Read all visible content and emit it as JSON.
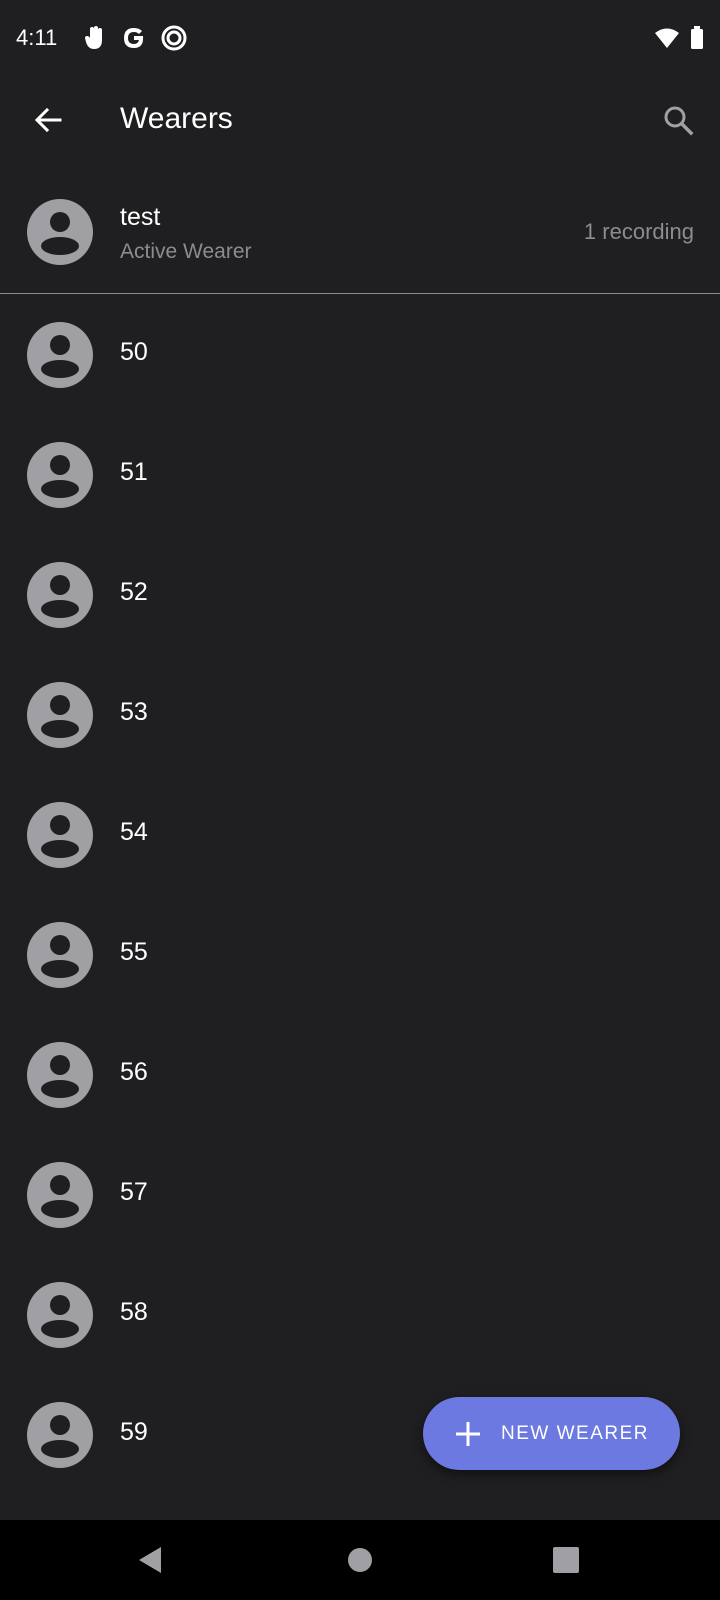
{
  "status_bar": {
    "time": "4:11",
    "left_icons": [
      "hand-icon",
      "google-icon",
      "circle-app-icon"
    ],
    "right_icons": [
      "wifi-icon",
      "battery-icon"
    ]
  },
  "app_bar": {
    "title": "Wearers",
    "back_icon": "arrow-back-icon",
    "search_icon": "search-icon"
  },
  "active_wearer": {
    "name": "test",
    "subtitle": "Active Wearer",
    "recordings": "1 recording"
  },
  "wearers": [
    {
      "name": "50"
    },
    {
      "name": "51"
    },
    {
      "name": "52"
    },
    {
      "name": "53"
    },
    {
      "name": "54"
    },
    {
      "name": "55"
    },
    {
      "name": "56"
    },
    {
      "name": "57"
    },
    {
      "name": "58"
    },
    {
      "name": "59"
    }
  ],
  "fab": {
    "label": "NEW WEARER",
    "icon": "plus-icon",
    "color": "#6b79e0"
  },
  "nav_bar": {
    "icons": [
      "nav-back-icon",
      "nav-home-icon",
      "nav-recents-icon"
    ]
  },
  "colors": {
    "background": "#1f1f21",
    "avatar": "#a0a0a4",
    "secondary_text": "#8c8c8f"
  }
}
